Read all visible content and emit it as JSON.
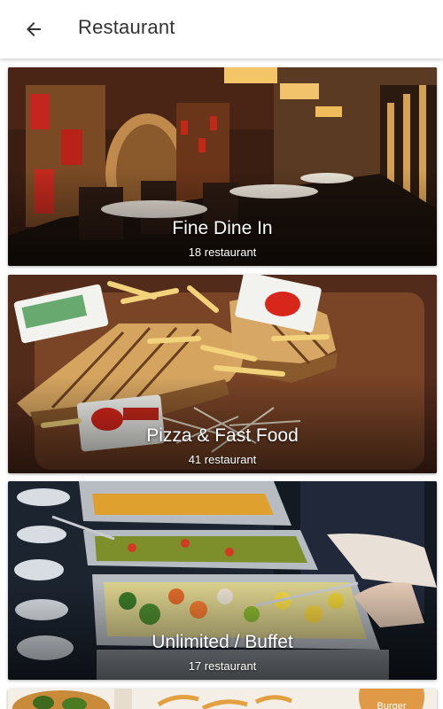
{
  "appbar": {
    "title": "Restaurant",
    "back_icon": "arrow-left-icon"
  },
  "categories": [
    {
      "title": "Fine Dine In",
      "count": "18 restaurant"
    },
    {
      "title": "Pizza & Fast Food",
      "count": "41 restaurant"
    },
    {
      "title": "Unlimited / Buffet",
      "count": "17 restaurant"
    },
    {
      "title": "",
      "count": "",
      "badge": "Burger"
    }
  ],
  "colors": {
    "appbar_bg": "#ffffff",
    "badge": "#e09a45"
  }
}
